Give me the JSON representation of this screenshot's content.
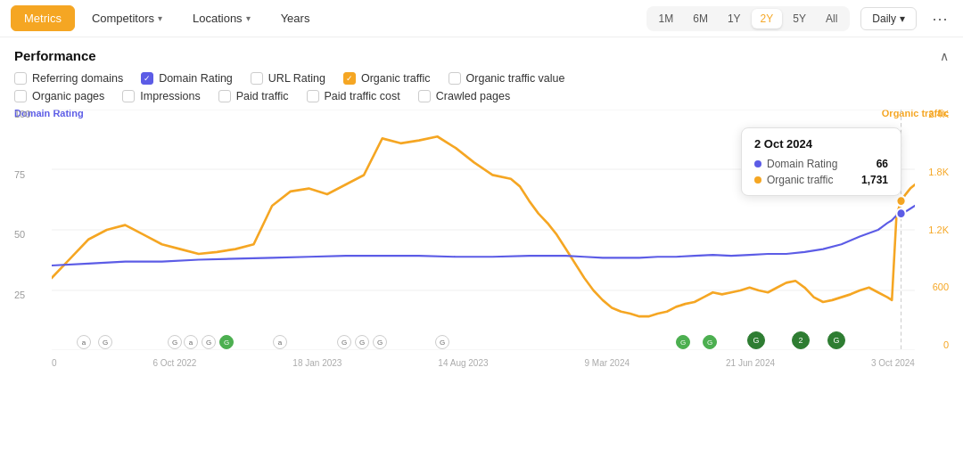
{
  "nav": {
    "tabs": [
      {
        "id": "metrics",
        "label": "Metrics",
        "active": true
      },
      {
        "id": "competitors",
        "label": "Competitors",
        "dropdown": true
      },
      {
        "id": "locations",
        "label": "Locations",
        "dropdown": true
      },
      {
        "id": "years",
        "label": "Years",
        "dropdown": false
      }
    ],
    "time_buttons": [
      "1M",
      "6M",
      "1Y",
      "2Y",
      "5Y",
      "All"
    ],
    "active_time": "2Y",
    "granularity": "Daily",
    "more_icon": "⋯"
  },
  "performance": {
    "title": "Performance",
    "collapse_icon": "∧",
    "checkboxes_row1": [
      {
        "id": "referring_domains",
        "label": "Referring domains",
        "checked": false,
        "color": "none"
      },
      {
        "id": "domain_rating",
        "label": "Domain Rating",
        "checked": true,
        "color": "purple"
      },
      {
        "id": "url_rating",
        "label": "URL Rating",
        "checked": false,
        "color": "none"
      },
      {
        "id": "organic_traffic",
        "label": "Organic traffic",
        "checked": true,
        "color": "orange"
      },
      {
        "id": "organic_traffic_value",
        "label": "Organic traffic value",
        "checked": false,
        "color": "none"
      }
    ],
    "checkboxes_row2": [
      {
        "id": "organic_pages",
        "label": "Organic pages",
        "checked": false,
        "color": "none"
      },
      {
        "id": "impressions",
        "label": "Impressions",
        "checked": false,
        "color": "none"
      },
      {
        "id": "paid_traffic",
        "label": "Paid traffic",
        "checked": false,
        "color": "none"
      },
      {
        "id": "paid_traffic_cost",
        "label": "Paid traffic cost",
        "checked": false,
        "color": "none"
      },
      {
        "id": "crawled_pages",
        "label": "Crawled pages",
        "checked": false,
        "color": "none"
      }
    ]
  },
  "chart": {
    "y_left_labels": [
      "100",
      "75",
      "50",
      "25",
      ""
    ],
    "y_right_labels": [
      "2.4K",
      "1.8K",
      "1.2K",
      "600",
      "0"
    ],
    "axis_left_label": "Domain Rating",
    "axis_right_label": "Organic traffic",
    "x_labels": [
      "0",
      "6 Oct 2022",
      "18 Jan 2023",
      "14 Aug 2023",
      "9 Mar 2024",
      "21 Jun 2024",
      "3 Oct 2024"
    ],
    "tooltip": {
      "date": "2 Oct 2024",
      "rows": [
        {
          "label": "Domain Rating",
          "value": "66",
          "color": "#5c5ce6"
        },
        {
          "label": "Organic traffic",
          "value": "1,731",
          "color": "#f5a623"
        }
      ]
    }
  },
  "colors": {
    "orange": "#f5a623",
    "purple": "#5c5ce6",
    "green": "#4caf50",
    "dark_green": "#2e7d32"
  }
}
